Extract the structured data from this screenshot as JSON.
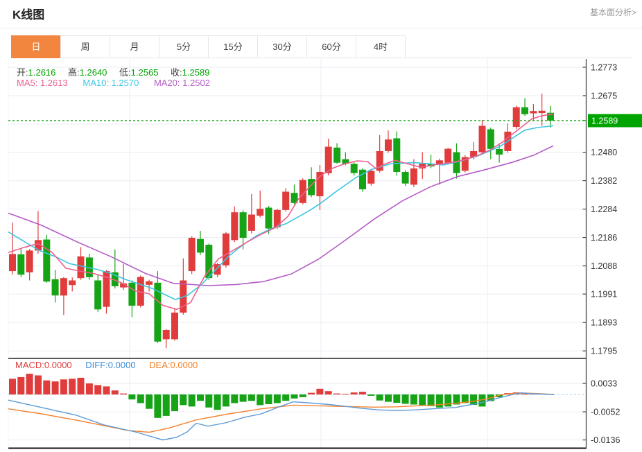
{
  "header": {
    "title": "K线图",
    "link": "基本面分析>"
  },
  "tabs": [
    {
      "label": "日",
      "active": true
    },
    {
      "label": "周",
      "active": false
    },
    {
      "label": "月",
      "active": false
    },
    {
      "label": "5分",
      "active": false
    },
    {
      "label": "15分",
      "active": false
    },
    {
      "label": "30分",
      "active": false
    },
    {
      "label": "60分",
      "active": false
    },
    {
      "label": "4时",
      "active": false
    }
  ],
  "legend": {
    "open_label": "开:",
    "high_label": "高:",
    "low_label": "低:",
    "close_label": "收:",
    "ma5_label": "MA5:",
    "ma10_label": "MA10:",
    "ma20_label": "MA20:",
    "macd_label": "MACD:",
    "diff_label": "DIFF:",
    "dea_label": "DEA:"
  },
  "chart_data": {
    "type": "candlestick",
    "title": "K线图",
    "period_selected": "日",
    "ohlc": {
      "open": "1.2616",
      "high": "1.2640",
      "low": "1.2565",
      "close": "1.2589"
    },
    "ma_values": {
      "ma5": "1.2613",
      "ma10": "1.2570",
      "ma20": "1.2502"
    },
    "macd_values": {
      "macd": "0.0000",
      "diff": "0.0000",
      "dea": "0.0000"
    },
    "main": {
      "ylim": [
        1.1795,
        1.2773
      ],
      "y_ticks": [
        {
          "v": 1.2773,
          "label": "1.2773"
        },
        {
          "v": 1.2675,
          "label": "1.2675"
        },
        {
          "v": 1.2577,
          "label": null
        },
        {
          "v": 1.248,
          "label": "1.2480"
        },
        {
          "v": 1.2382,
          "label": "1.2382"
        },
        {
          "v": 1.2284,
          "label": "1.2284"
        },
        {
          "v": 1.2186,
          "label": "1.2186"
        },
        {
          "v": 1.2088,
          "label": "1.2088"
        },
        {
          "v": 1.1991,
          "label": "1.1991"
        },
        {
          "v": 1.1893,
          "label": "1.1893"
        },
        {
          "v": 1.1795,
          "label": "1.1795"
        }
      ],
      "current_price": {
        "v": 1.2589,
        "label": "1.2589"
      },
      "candles_ohlc": [
        [
          1.207,
          1.2237,
          1.2058,
          1.2129
        ],
        [
          1.2128,
          1.2149,
          1.205,
          1.2058
        ],
        [
          1.2066,
          1.2146,
          1.2038,
          1.2141
        ],
        [
          1.2141,
          1.2277,
          1.213,
          1.2177
        ],
        [
          1.2179,
          1.2195,
          1.203,
          1.2034
        ],
        [
          1.2042,
          1.2074,
          1.1962,
          1.1986
        ],
        [
          1.1986,
          1.205,
          1.1919,
          1.2046
        ],
        [
          1.2022,
          1.2048,
          1.2,
          1.2038
        ],
        [
          1.2046,
          1.2153,
          1.204,
          1.2121
        ],
        [
          1.2117,
          1.213,
          1.204,
          1.2049
        ],
        [
          1.2038,
          1.206,
          1.193,
          1.1938
        ],
        [
          1.1947,
          1.2074,
          1.1923,
          1.207
        ],
        [
          1.2066,
          1.2145,
          1.201,
          1.2018
        ],
        [
          1.2014,
          1.2095,
          1.2005,
          1.2028
        ],
        [
          1.203,
          1.2038,
          1.1911,
          1.1951
        ],
        [
          1.1951,
          1.2055,
          1.1945,
          1.205
        ],
        [
          1.2023,
          1.204,
          1.2,
          1.2035
        ],
        [
          1.203,
          1.207,
          1.1822,
          1.1827
        ],
        [
          1.1835,
          1.187,
          1.1804,
          1.1867
        ],
        [
          1.1835,
          1.1943,
          1.183,
          1.1927
        ],
        [
          1.1927,
          1.2114,
          1.192,
          1.2038
        ],
        [
          1.207,
          1.219,
          1.206,
          1.2185
        ],
        [
          1.2181,
          1.2209,
          1.2125,
          1.2134
        ],
        [
          1.2161,
          1.2165,
          1.204,
          1.2046
        ],
        [
          1.2058,
          1.2098,
          1.205,
          1.2094
        ],
        [
          1.209,
          1.2205,
          1.2082,
          1.22
        ],
        [
          1.2177,
          1.2293,
          1.217,
          1.2273
        ],
        [
          1.2273,
          1.228,
          1.2145,
          1.2185
        ],
        [
          1.2209,
          1.2336,
          1.22,
          1.2265
        ],
        [
          1.2261,
          1.2348,
          1.2255,
          1.2285
        ],
        [
          1.2289,
          1.2295,
          1.2198,
          1.2217
        ],
        [
          1.2221,
          1.2285,
          1.2215,
          1.2281
        ],
        [
          1.2281,
          1.2356,
          1.2275,
          1.2344
        ],
        [
          1.234,
          1.2368,
          1.23,
          1.2305
        ],
        [
          1.2305,
          1.239,
          1.23,
          1.2384
        ],
        [
          1.2388,
          1.2428,
          1.2325,
          1.2332
        ],
        [
          1.2328,
          1.2436,
          1.2281,
          1.2412
        ],
        [
          1.2408,
          1.2527,
          1.24,
          1.2499
        ],
        [
          1.2496,
          1.2511,
          1.244,
          1.2444
        ],
        [
          1.2456,
          1.248,
          1.2435,
          1.244
        ],
        [
          1.244,
          1.2445,
          1.24,
          1.2408
        ],
        [
          1.242,
          1.2425,
          1.2344,
          1.2352
        ],
        [
          1.2372,
          1.242,
          1.2365,
          1.2416
        ],
        [
          1.2416,
          1.2539,
          1.241,
          1.2484
        ],
        [
          1.2484,
          1.2555,
          1.2478,
          1.2524
        ],
        [
          1.2528,
          1.2552,
          1.24,
          1.2412
        ],
        [
          1.2412,
          1.2418,
          1.2364,
          1.2372
        ],
        [
          1.2368,
          1.2456,
          1.236,
          1.2424
        ],
        [
          1.2424,
          1.248,
          1.2388,
          1.244
        ],
        [
          1.2441,
          1.2472,
          1.2425,
          1.2431
        ],
        [
          1.2436,
          1.2458,
          1.2368,
          1.2452
        ],
        [
          1.2444,
          1.2495,
          1.2438,
          1.2492
        ],
        [
          1.248,
          1.2511,
          1.2389,
          1.2408
        ],
        [
          1.2416,
          1.247,
          1.241,
          1.2463
        ],
        [
          1.2463,
          1.2515,
          1.2455,
          1.2484
        ],
        [
          1.248,
          1.2591,
          1.2475,
          1.2571
        ],
        [
          1.2559,
          1.2565,
          1.2456,
          1.2491
        ],
        [
          1.2491,
          1.2511,
          1.2444,
          1.2472
        ],
        [
          1.2484,
          1.2579,
          1.2478,
          1.2551
        ],
        [
          1.2567,
          1.264,
          1.256,
          1.2635
        ],
        [
          1.2635,
          1.2666,
          1.2605,
          1.2611
        ],
        [
          1.2614,
          1.2646,
          1.2587,
          1.2622
        ],
        [
          1.2615,
          1.2682,
          1.2571,
          1.2623
        ],
        [
          1.2616,
          1.264,
          1.2565,
          1.2589
        ]
      ],
      "ma5_line": [
        [
          12,
          1.2134
        ],
        [
          35,
          1.2152
        ],
        [
          55,
          1.2165
        ],
        [
          75,
          1.2135
        ],
        [
          95,
          1.208
        ],
        [
          115,
          1.207
        ],
        [
          135,
          1.2062
        ],
        [
          155,
          1.2048
        ],
        [
          175,
          1.203
        ],
        [
          195,
          1.2002
        ],
        [
          215,
          1.1992
        ],
        [
          235,
          1.1952
        ],
        [
          255,
          1.1938
        ],
        [
          275,
          1.1962
        ],
        [
          295,
          1.2052
        ],
        [
          315,
          1.2112
        ],
        [
          335,
          1.214
        ],
        [
          355,
          1.2168
        ],
        [
          375,
          1.2195
        ],
        [
          397,
          1.222
        ],
        [
          415,
          1.2258
        ],
        [
          430,
          1.2317
        ],
        [
          447,
          1.2362
        ],
        [
          463,
          1.24
        ],
        [
          480,
          1.2425
        ],
        [
          497,
          1.244
        ],
        [
          515,
          1.245
        ],
        [
          530,
          1.2448
        ],
        [
          542,
          1.2424
        ],
        [
          556,
          1.244
        ],
        [
          570,
          1.2452
        ],
        [
          585,
          1.2442
        ],
        [
          607,
          1.2428
        ],
        [
          630,
          1.2438
        ],
        [
          655,
          1.2446
        ],
        [
          673,
          1.2456
        ],
        [
          690,
          1.247
        ],
        [
          707,
          1.2488
        ],
        [
          725,
          1.2515
        ],
        [
          740,
          1.2544
        ],
        [
          755,
          1.2572
        ],
        [
          767,
          1.2595
        ],
        [
          782,
          1.2606
        ],
        [
          798,
          1.2612
        ]
      ],
      "ma10_line": [
        [
          12,
          1.2205
        ],
        [
          40,
          1.2165
        ],
        [
          57,
          1.2141
        ],
        [
          80,
          1.212
        ],
        [
          100,
          1.2096
        ],
        [
          120,
          1.2086
        ],
        [
          140,
          1.2076
        ],
        [
          160,
          1.2062
        ],
        [
          180,
          1.2042
        ],
        [
          200,
          1.2026
        ],
        [
          220,
          1.201
        ],
        [
          237,
          1.199
        ],
        [
          253,
          1.1972
        ],
        [
          270,
          1.1986
        ],
        [
          290,
          1.2022
        ],
        [
          310,
          1.2072
        ],
        [
          330,
          1.2122
        ],
        [
          350,
          1.216
        ],
        [
          370,
          1.2192
        ],
        [
          390,
          1.2215
        ],
        [
          413,
          1.2234
        ],
        [
          430,
          1.2257
        ],
        [
          447,
          1.228
        ],
        [
          463,
          1.2305
        ],
        [
          485,
          1.2345
        ],
        [
          513,
          1.2392
        ],
        [
          535,
          1.242
        ],
        [
          563,
          1.244
        ],
        [
          597,
          1.2444
        ],
        [
          620,
          1.244
        ],
        [
          640,
          1.2436
        ],
        [
          665,
          1.245
        ],
        [
          690,
          1.2468
        ],
        [
          710,
          1.2488
        ],
        [
          723,
          1.2503
        ],
        [
          740,
          1.253
        ],
        [
          757,
          1.2556
        ],
        [
          775,
          1.2565
        ],
        [
          798,
          1.2571
        ]
      ],
      "ma20_line": [
        [
          12,
          1.227
        ],
        [
          60,
          1.2228
        ],
        [
          110,
          1.2172
        ],
        [
          160,
          1.212
        ],
        [
          210,
          1.2062
        ],
        [
          250,
          1.2028
        ],
        [
          300,
          1.202
        ],
        [
          340,
          1.2024
        ],
        [
          380,
          1.2034
        ],
        [
          420,
          1.206
        ],
        [
          460,
          1.2112
        ],
        [
          500,
          1.218
        ],
        [
          540,
          1.225
        ],
        [
          580,
          1.2312
        ],
        [
          620,
          1.236
        ],
        [
          660,
          1.2396
        ],
        [
          700,
          1.242
        ],
        [
          740,
          1.2446
        ],
        [
          770,
          1.247
        ],
        [
          798,
          1.2502
        ]
      ]
    },
    "macd": {
      "y_ticks": [
        {
          "v": 0.0033,
          "label": "0.0033"
        },
        {
          "v": -0.0052,
          "label": "-0.0052"
        },
        {
          "v": -0.0136,
          "label": "-0.0136"
        }
      ],
      "histogram": [
        0.0047,
        0.0052,
        0.0062,
        0.0057,
        0.0042,
        0.0039,
        0.0045,
        0.0047,
        0.005,
        0.0033,
        0.0028,
        0.0024,
        0.0012,
        0.0003,
        -0.0015,
        -0.0026,
        -0.0043,
        -0.007,
        -0.0064,
        -0.005,
        -0.0032,
        -0.0036,
        -0.0019,
        -0.0039,
        -0.0046,
        -0.0036,
        -0.0026,
        -0.0022,
        -0.0019,
        -0.0032,
        -0.0029,
        -0.0026,
        -0.0019,
        -0.0012,
        -0.0008,
        0.0005,
        0.0017,
        0.001,
        0.0003,
        0.0002,
        0.0006,
        0.0008,
        -0.0004,
        -0.0018,
        -0.0022,
        -0.0025,
        -0.0028,
        -0.003,
        -0.0032,
        -0.0035,
        -0.0039,
        -0.0036,
        -0.003,
        -0.0026,
        -0.0031,
        -0.0036,
        -0.002,
        -0.0008,
        0.0004,
        0.0006,
        0.0002,
        0.0001,
        0.0001,
        0.0
      ],
      "diff_line": [
        [
          12,
          -0.0017
        ],
        [
          60,
          -0.0039
        ],
        [
          110,
          -0.0062
        ],
        [
          150,
          -0.0091
        ],
        [
          195,
          -0.0112
        ],
        [
          235,
          -0.0136
        ],
        [
          255,
          -0.0128
        ],
        [
          270,
          -0.0112
        ],
        [
          283,
          -0.0086
        ],
        [
          300,
          -0.0095
        ],
        [
          327,
          -0.0084
        ],
        [
          353,
          -0.0068
        ],
        [
          377,
          -0.0058
        ],
        [
          400,
          -0.0039
        ],
        [
          423,
          -0.0022
        ],
        [
          450,
          -0.0026
        ],
        [
          480,
          -0.0031
        ],
        [
          520,
          -0.0041
        ],
        [
          545,
          -0.0046
        ],
        [
          573,
          -0.0048
        ],
        [
          600,
          -0.0046
        ],
        [
          630,
          -0.0042
        ],
        [
          657,
          -0.0039
        ],
        [
          680,
          -0.003
        ],
        [
          700,
          -0.0022
        ],
        [
          720,
          -0.001
        ],
        [
          740,
          0.0
        ],
        [
          752,
          0.0005
        ],
        [
          767,
          0.0002
        ],
        [
          798,
          0.0
        ]
      ],
      "dea_line": [
        [
          12,
          -0.0043
        ],
        [
          60,
          -0.0058
        ],
        [
          110,
          -0.0077
        ],
        [
          150,
          -0.0093
        ],
        [
          185,
          -0.0108
        ],
        [
          215,
          -0.0113
        ],
        [
          243,
          -0.0101
        ],
        [
          283,
          -0.0076
        ],
        [
          327,
          -0.0059
        ],
        [
          377,
          -0.0043
        ],
        [
          423,
          -0.0032
        ],
        [
          460,
          -0.0034
        ],
        [
          500,
          -0.0036
        ],
        [
          540,
          -0.0038
        ],
        [
          573,
          -0.0037
        ],
        [
          600,
          -0.0034
        ],
        [
          630,
          -0.0031
        ],
        [
          660,
          -0.0026
        ],
        [
          685,
          -0.002
        ],
        [
          705,
          -0.0012
        ],
        [
          722,
          -0.0001
        ],
        [
          740,
          0.0003
        ],
        [
          760,
          0.0004
        ],
        [
          780,
          0.0002
        ],
        [
          798,
          0.0
        ]
      ]
    },
    "colors": {
      "up": "#e03c3c",
      "down": "#16a316",
      "price_tag": "#00a400",
      "price_line": "#22a822",
      "ma5": "#ee5f8e",
      "ma10": "#3bc6e3",
      "ma20": "#b55bc8",
      "diff": "#5b9bd5",
      "dea": "#f5822d",
      "macd_label": "#e03c3c",
      "diff_label": "#3d8fd8",
      "dea_label": "#f08128",
      "ohlc_value": "#00a400",
      "tab_active_bg": "#f2863e",
      "grid": "#e9eef4",
      "axis": "#444444",
      "zero_dash": "#b8d4ea"
    }
  }
}
